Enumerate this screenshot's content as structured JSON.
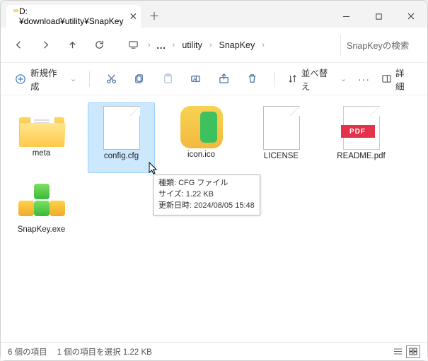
{
  "tab": {
    "title": "D:¥download¥utility¥SnapKey"
  },
  "breadcrumb": {
    "seg1": "utility",
    "seg2": "SnapKey"
  },
  "search": {
    "placeholder": "SnapKeyの検索"
  },
  "cmd": {
    "new_label": "新規作成",
    "sort_label": "並べ替え",
    "detail_label": "詳細",
    "pdf_band": "PDF"
  },
  "files": {
    "meta": "meta",
    "config": "config.cfg",
    "icon": "icon.ico",
    "license": "LICENSE",
    "readme": "README.pdf",
    "snapkey": "SnapKey.exe"
  },
  "tooltip": {
    "line1": "種類: CFG ファイル",
    "line2": "サイズ: 1.22 KB",
    "line3": "更新日時: 2024/08/05 15:48"
  },
  "status": {
    "count": "6 個の項目",
    "selection": "1 個の項目を選択 1.22 KB"
  }
}
